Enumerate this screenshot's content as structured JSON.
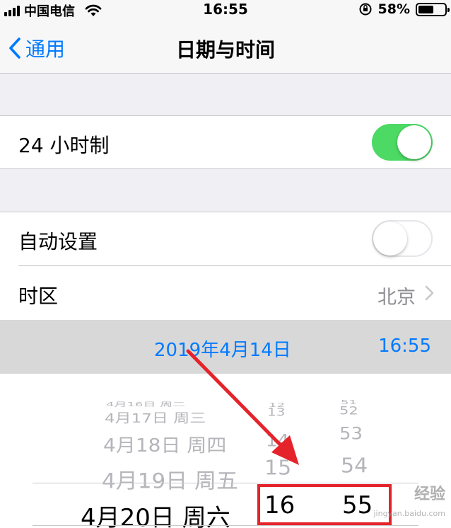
{
  "status_bar": {
    "carrier": "中国电信",
    "time": "16:55",
    "battery": "58%",
    "battery_level": 0.58
  },
  "nav": {
    "back_label": "通用",
    "title": "日期与时间"
  },
  "rows": {
    "h24": {
      "label": "24 小时制",
      "toggle_on": true
    },
    "auto": {
      "label": "自动设置",
      "toggle_on": false
    },
    "timezone": {
      "label": "时区",
      "value": "北京"
    }
  },
  "datetime": {
    "date": "2019年4月14日",
    "time": "16:55"
  },
  "picker": {
    "dates": [
      "4月16日 周二",
      "4月17日 周三",
      "4月18日 周四",
      "4月19日 周五",
      "4月20日 周六"
    ],
    "hours": [
      "12",
      "13",
      "14",
      "15",
      "16"
    ],
    "minutes": [
      "51",
      "52",
      "53",
      "54",
      "55"
    ],
    "selected": {
      "date": "4月20日 周六",
      "hour": "16",
      "minute": "55"
    }
  },
  "watermark": {
    "text": "经验",
    "url": "jingyan.baidu.com"
  },
  "colors": {
    "accent": "#007aff",
    "toggle_on": "#4cd964",
    "annotation": "#e5232a"
  }
}
